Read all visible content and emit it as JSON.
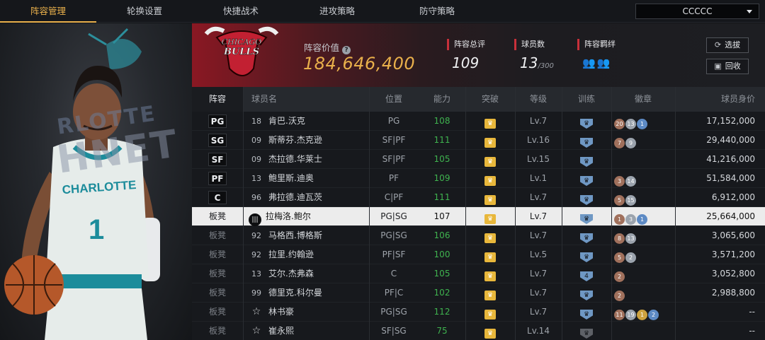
{
  "tabs": [
    {
      "label": "阵容管理",
      "active": true
    },
    {
      "label": "轮换设置",
      "active": false
    },
    {
      "label": "快捷战术",
      "active": false
    },
    {
      "label": "进攻策略",
      "active": false
    },
    {
      "label": "防守策略",
      "active": false
    }
  ],
  "team_select": {
    "value": "CCCCC"
  },
  "portrait": {
    "logo_line1": "RLOTTE",
    "logo_line2": "HNET"
  },
  "header": {
    "value_label": "阵容价值",
    "value": "184,646,400",
    "overall_label": "阵容总评",
    "overall": "109",
    "players_label": "球员数",
    "players": "13",
    "players_max": "/300",
    "bond_label": "阵容羁绊",
    "select_button": "选拔",
    "recycle_button": "回收"
  },
  "columns": [
    "阵容",
    "球员名",
    "位置",
    "能力",
    "突破",
    "等级",
    "训练",
    "徽章",
    "球员身价"
  ],
  "rows": [
    {
      "slot": "PG",
      "bench": false,
      "num": "18",
      "icon": "number",
      "name": "肯巴.沃克",
      "pos": "PG",
      "ability": "108",
      "green": true,
      "level": "Lv.7",
      "train": "",
      "badges": [
        [
          "bronze",
          "20"
        ],
        [
          "silver",
          "13"
        ],
        [
          "blue",
          "1"
        ]
      ],
      "salary": "17,152,000"
    },
    {
      "slot": "SG",
      "bench": false,
      "num": "09",
      "icon": "number",
      "name": "斯蒂芬.杰克逊",
      "pos": "SF|PF",
      "ability": "111",
      "green": true,
      "level": "Lv.16",
      "train": "",
      "badges": [
        [
          "bronze",
          "7"
        ],
        [
          "silver",
          "9"
        ]
      ],
      "salary": "29,440,000"
    },
    {
      "slot": "SF",
      "bench": false,
      "num": "09",
      "icon": "number",
      "name": "杰拉德.华莱士",
      "pos": "SF|PF",
      "ability": "105",
      "green": true,
      "level": "Lv.15",
      "train": "",
      "badges": [],
      "salary": "41,216,000"
    },
    {
      "slot": "PF",
      "bench": false,
      "num": "13",
      "icon": "number",
      "name": "鲍里斯.迪奥",
      "pos": "PF",
      "ability": "109",
      "green": true,
      "level": "Lv.1",
      "train": "",
      "badges": [
        [
          "bronze",
          "3"
        ],
        [
          "silver",
          "14"
        ]
      ],
      "salary": "51,584,000"
    },
    {
      "slot": "C",
      "bench": false,
      "num": "96",
      "icon": "number",
      "name": "弗拉德.迪瓦茨",
      "pos": "C|PF",
      "ability": "111",
      "green": true,
      "level": "Lv.7",
      "train": "",
      "badges": [
        [
          "bronze",
          "5"
        ],
        [
          "silver",
          "15"
        ]
      ],
      "salary": "6,912,000"
    },
    {
      "slot": "板凳",
      "bench": true,
      "selected": true,
      "num": "",
      "icon": "jersey",
      "name": "拉梅洛.鲍尔",
      "pos": "PG|SG",
      "ability": "107",
      "green": false,
      "level": "Lv.7",
      "train": "",
      "badges": [
        [
          "bronze",
          "1"
        ],
        [
          "silver",
          "3"
        ],
        [
          "blue",
          "1"
        ]
      ],
      "salary": "25,664,000"
    },
    {
      "slot": "板凳",
      "bench": true,
      "num": "92",
      "icon": "number",
      "name": "马格西.博格斯",
      "pos": "PG|SG",
      "ability": "106",
      "green": true,
      "level": "Lv.7",
      "train": "",
      "badges": [
        [
          "bronze",
          "8"
        ],
        [
          "silver",
          "13"
        ]
      ],
      "salary": "3,065,600"
    },
    {
      "slot": "板凳",
      "bench": true,
      "num": "92",
      "icon": "number",
      "name": "拉里.约翰逊",
      "pos": "PF|SF",
      "ability": "100",
      "green": true,
      "level": "Lv.5",
      "train": "",
      "badges": [
        [
          "bronze",
          "5"
        ],
        [
          "silver",
          "2"
        ]
      ],
      "salary": "3,571,200"
    },
    {
      "slot": "板凳",
      "bench": true,
      "num": "13",
      "icon": "number",
      "name": "艾尔.杰弗森",
      "pos": "C",
      "ability": "105",
      "green": true,
      "level": "Lv.7",
      "train": "4",
      "badges": [
        [
          "bronze",
          "2"
        ]
      ],
      "salary": "3,052,800"
    },
    {
      "slot": "板凳",
      "bench": true,
      "num": "99",
      "icon": "number",
      "name": "德里克.科尔曼",
      "pos": "PF|C",
      "ability": "102",
      "green": true,
      "level": "Lv.7",
      "train": "",
      "badges": [
        [
          "bronze",
          "2"
        ]
      ],
      "salary": "2,988,800"
    },
    {
      "slot": "板凳",
      "bench": true,
      "num": "",
      "icon": "star",
      "name": "林书豪",
      "pos": "PG|SG",
      "ability": "112",
      "green": true,
      "level": "Lv.7",
      "train": "",
      "badges": [
        [
          "bronze",
          "11"
        ],
        [
          "silver",
          "19"
        ],
        [
          "gold",
          "1"
        ],
        [
          "blue",
          "2"
        ]
      ],
      "salary": "--"
    },
    {
      "slot": "板凳",
      "bench": true,
      "num": "",
      "icon": "star",
      "name": "崔永熙",
      "pos": "SF|SG",
      "ability": "75",
      "green": true,
      "level": "Lv.14",
      "train": "",
      "trainGrey": true,
      "badges": [],
      "salary": "--"
    }
  ]
}
